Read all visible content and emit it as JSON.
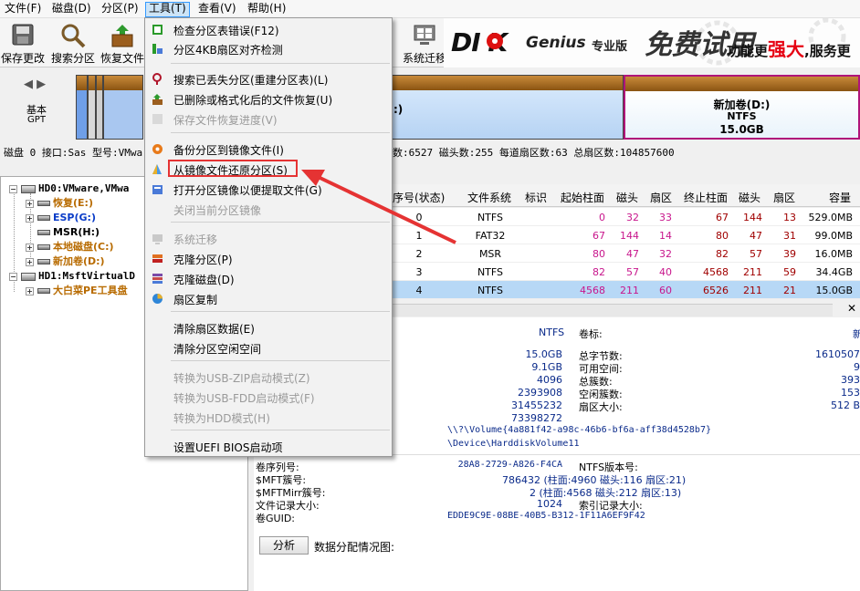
{
  "menubar": {
    "items": [
      "文件(F)",
      "磁盘(D)",
      "分区(P)",
      "工具(T)",
      "查看(V)",
      "帮助(H)"
    ]
  },
  "toolbar": {
    "save": "保存更改",
    "search": "搜索分区",
    "restore": "恢复文件",
    "migrate": "系统迁移"
  },
  "banner": {
    "brand_dk": "DI  K",
    "brand_genius": "Genius",
    "edition": "专业版",
    "free_trial": "免费试用",
    "slogan_a": "功能更",
    "slogan_strong": "强大",
    "slogan_b": ",服务更"
  },
  "disk_strip": {
    "basic": "基本",
    "gpt": "GPT",
    "volume_d": {
      "name": "新加卷(D:)",
      "fs": "NTFS",
      "size": "15.0GB"
    },
    "colon_fragment": ":)",
    "info": "磁盘 0 接口:Sas  型号:VMwa",
    "info_right": "数:6527  磁头数:255  每道扇区数:63  总扇区数:104857600"
  },
  "tree": {
    "hd0": "HD0:VMware,VMwa",
    "hd0_parts": [
      {
        "label": "恢复(E:)",
        "color": "orange"
      },
      {
        "label": "ESP(G:)",
        "color": "blue"
      },
      {
        "label": "MSR(H:)",
        "color": "black"
      },
      {
        "label": "本地磁盘(C:)",
        "color": "orange"
      },
      {
        "label": "新加卷(D:)",
        "color": "orange"
      }
    ],
    "hd1": "HD1:MsftVirtualD",
    "hd1_parts": [
      {
        "label": "大白菜PE工具盘",
        "color": "orange"
      }
    ]
  },
  "table": {
    "headers": [
      "序号(状态)",
      "文件系统",
      "标识",
      "起始柱面",
      "磁头",
      "扇区",
      "终止柱面",
      "磁头",
      "扇区",
      "容量"
    ],
    "rows": [
      [
        "0",
        "NTFS",
        "",
        "0",
        "32",
        "33",
        "67",
        "144",
        "13",
        "529.0MB"
      ],
      [
        "1",
        "FAT32",
        "",
        "67",
        "144",
        "14",
        "80",
        "47",
        "31",
        "99.0MB"
      ],
      [
        "2",
        "MSR",
        "",
        "80",
        "47",
        "32",
        "82",
        "57",
        "39",
        "16.0MB"
      ],
      [
        "3",
        "NTFS",
        "",
        "82",
        "57",
        "40",
        "4568",
        "211",
        "59",
        "34.4GB"
      ],
      [
        "4",
        "NTFS",
        "",
        "4568",
        "211",
        "60",
        "6526",
        "211",
        "21",
        "15.0GB"
      ]
    ]
  },
  "details": {
    "fs_value": "NTFS",
    "label_key": "卷标:",
    "label_value": "新",
    "size_value": "15.0GB",
    "total_bytes_key": "总字节数:",
    "total_bytes_value": "1610507",
    "free_value": "9.1GB",
    "free_key": "可用空间:",
    "free_right": "9",
    "cluster_size_value": "4096",
    "total_clusters_key": "总簇数:",
    "total_clusters_value": "393",
    "c4": "2393908",
    "free_clusters_key": "空闲簇数:",
    "free_clusters_value": "153",
    "c5": "31455232",
    "sector_size_key": "扇区大小:",
    "sector_size_value": "512 B",
    "c6": "73398272",
    "volume_path": "\\\\?\\Volume{4a881f42-a98c-46b6-bf6a-aff38d4528b7}",
    "device_path": "\\Device\\HarddiskVolume11",
    "serial_key": "卷序列号:",
    "serial_value": "28A8-2729-A826-F4CA",
    "ntfs_ver_key": "NTFS版本号:",
    "mft_key": "$MFT簇号:",
    "mft_value": "786432 (柱面:4960 磁头:116 扇区:21)",
    "mftmirr_key": "$MFTMirr簇号:",
    "mftmirr_value": "2 (柱面:4568 磁头:212 扇区:13)",
    "record_size_key": "文件记录大小:",
    "record_size_value": "1024",
    "index_size_key": "索引记录大小:",
    "guid_key": "卷GUID:",
    "guid_value": "EDDE9C9E-08BE-40B5-B312-1F11A6EF9F42",
    "analyze_button": "分析",
    "alloc_label": "数据分配情况图:"
  },
  "dropdown": {
    "items": [
      {
        "label": "检查分区表错误(F12)",
        "disabled": false,
        "icon": "check-table-icon"
      },
      {
        "label": "分区4KB扇区对齐检测",
        "disabled": false,
        "icon": "align-4k-icon"
      },
      {
        "label": "搜索已丢失分区(重建分区表)(L)",
        "disabled": false,
        "icon": "search-lost-icon"
      },
      {
        "label": "已删除或格式化后的文件恢复(U)",
        "disabled": false,
        "icon": "recover-files-icon"
      },
      {
        "label": "保存文件恢复进度(V)",
        "disabled": true,
        "icon": "save-progress-icon"
      },
      {
        "label": "备份分区到镜像文件(I)",
        "disabled": false,
        "icon": "backup-image-icon"
      },
      {
        "label": "从镜像文件还原分区(S)",
        "disabled": false,
        "icon": "restore-image-icon"
      },
      {
        "label": "打开分区镜像以便提取文件(G)",
        "disabled": false,
        "icon": "open-image-icon"
      },
      {
        "label": "关闭当前分区镜像",
        "disabled": true,
        "icon": ""
      },
      {
        "label": "系统迁移",
        "disabled": true,
        "icon": "migrate-icon"
      },
      {
        "label": "克隆分区(P)",
        "disabled": false,
        "icon": "clone-partition-icon"
      },
      {
        "label": "克隆磁盘(D)",
        "disabled": false,
        "icon": "clone-disk-icon"
      },
      {
        "label": "扇区复制",
        "disabled": false,
        "icon": "sector-copy-icon"
      },
      {
        "label": "清除扇区数据(E)",
        "disabled": false,
        "icon": ""
      },
      {
        "label": "清除分区空闲空间",
        "disabled": false,
        "icon": ""
      },
      {
        "label": "转换为USB-ZIP启动模式(Z)",
        "disabled": true,
        "icon": ""
      },
      {
        "label": "转换为USB-FDD启动模式(F)",
        "disabled": true,
        "icon": ""
      },
      {
        "label": "转换为HDD模式(H)",
        "disabled": true,
        "icon": ""
      },
      {
        "label": "设置UEFI BIOS启动项",
        "disabled": false,
        "icon": ""
      }
    ]
  },
  "colors": {
    "highlight_box": "#e53333",
    "volume_d_border": "#b0147a",
    "partition_header": "#8a5412",
    "selected_row": "#b7d8f6"
  }
}
